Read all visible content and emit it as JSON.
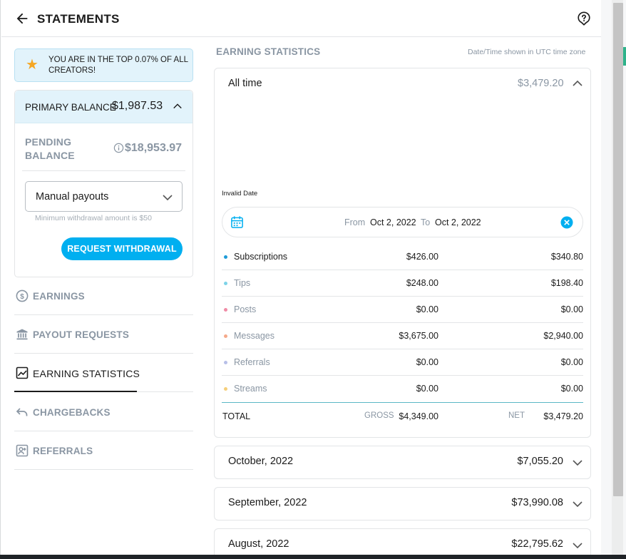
{
  "header": {
    "title": "STATEMENTS"
  },
  "promo": {
    "text": "YOU ARE IN THE TOP 0.07% OF ALL CREATORS!"
  },
  "balance": {
    "primary_label": "PRIMARY BALANCE",
    "primary_value": "$1,987.53",
    "pending_label": "PENDING BALANCE",
    "pending_value": "$18,953.97",
    "payout_mode": "Manual payouts",
    "min_withdrawal": "Minimum withdrawal amount is $50",
    "request_button": "REQUEST WITHDRAWAL"
  },
  "nav": {
    "items": [
      {
        "label": "EARNINGS",
        "icon": "dollar-circle-icon",
        "active": false
      },
      {
        "label": "PAYOUT REQUESTS",
        "icon": "bank-icon",
        "active": false
      },
      {
        "label": "EARNING STATISTICS",
        "icon": "chart-line-icon",
        "active": true
      },
      {
        "label": "CHARGEBACKS",
        "icon": "undo-arrow-icon",
        "active": false
      },
      {
        "label": "REFERRALS",
        "icon": "referral-icon",
        "active": false
      }
    ]
  },
  "stats": {
    "section_title": "EARNING STATISTICS",
    "timezone_note": "Date/Time shown in UTC time zone",
    "period": "All time",
    "period_total": "$3,479.20",
    "invalid_date": "Invalid Date",
    "range": {
      "from_label": "From",
      "from_value": "Oct 2, 2022",
      "to_label": "To",
      "to_value": "Oct 2, 2022"
    },
    "rows": [
      {
        "name": "Subscriptions",
        "gross": "$426.00",
        "net": "$340.80",
        "dot_color": "#1e9bd8"
      },
      {
        "name": "Tips",
        "gross": "$248.00",
        "net": "$198.40",
        "dot_color": "#7dd3e8"
      },
      {
        "name": "Posts",
        "gross": "$0.00",
        "net": "$0.00",
        "dot_color": "#f08ba6"
      },
      {
        "name": "Messages",
        "gross": "$3,675.00",
        "net": "$2,940.00",
        "dot_color": "#f5a98a"
      },
      {
        "name": "Referrals",
        "gross": "$0.00",
        "net": "$0.00",
        "dot_color": "#b7bfe8"
      },
      {
        "name": "Streams",
        "gross": "$0.00",
        "net": "$0.00",
        "dot_color": "#f5cf7a"
      }
    ],
    "total": {
      "label": "TOTAL",
      "gross_label": "GROSS",
      "gross_value": "$4,349.00",
      "net_label": "NET",
      "net_value": "$3,479.20"
    }
  },
  "months": [
    {
      "label": "October, 2022",
      "amount": "$7,055.20"
    },
    {
      "label": "September, 2022",
      "amount": "$73,990.08"
    },
    {
      "label": "August, 2022",
      "amount": "$22,795.62"
    }
  ],
  "colors": {
    "accent": "#00aff0",
    "muted": "#8a96a3",
    "promo_bg": "#e2f3fb"
  }
}
